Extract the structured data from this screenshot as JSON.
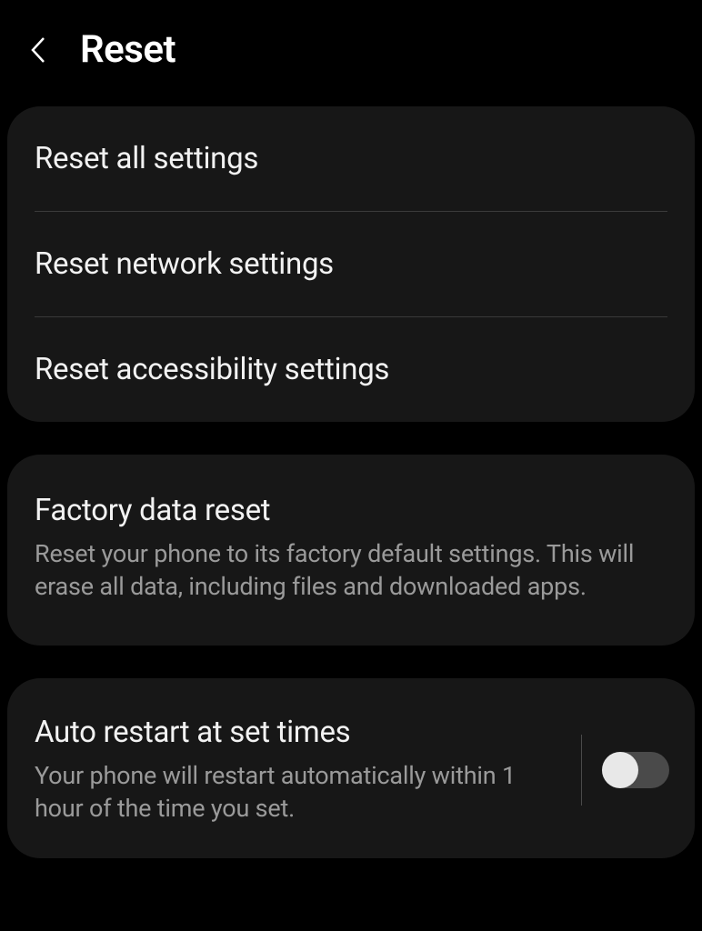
{
  "header": {
    "title": "Reset"
  },
  "section1": {
    "items": [
      {
        "title": "Reset all settings"
      },
      {
        "title": "Reset network settings"
      },
      {
        "title": "Reset accessibility settings"
      }
    ]
  },
  "section2": {
    "title": "Factory data reset",
    "subtitle": "Reset your phone to its factory default settings. This will erase all data, including files and downloaded apps."
  },
  "section3": {
    "title": "Auto restart at set times",
    "subtitle": "Your phone will restart automatically within 1 hour of the time you set.",
    "toggle_on": false
  }
}
